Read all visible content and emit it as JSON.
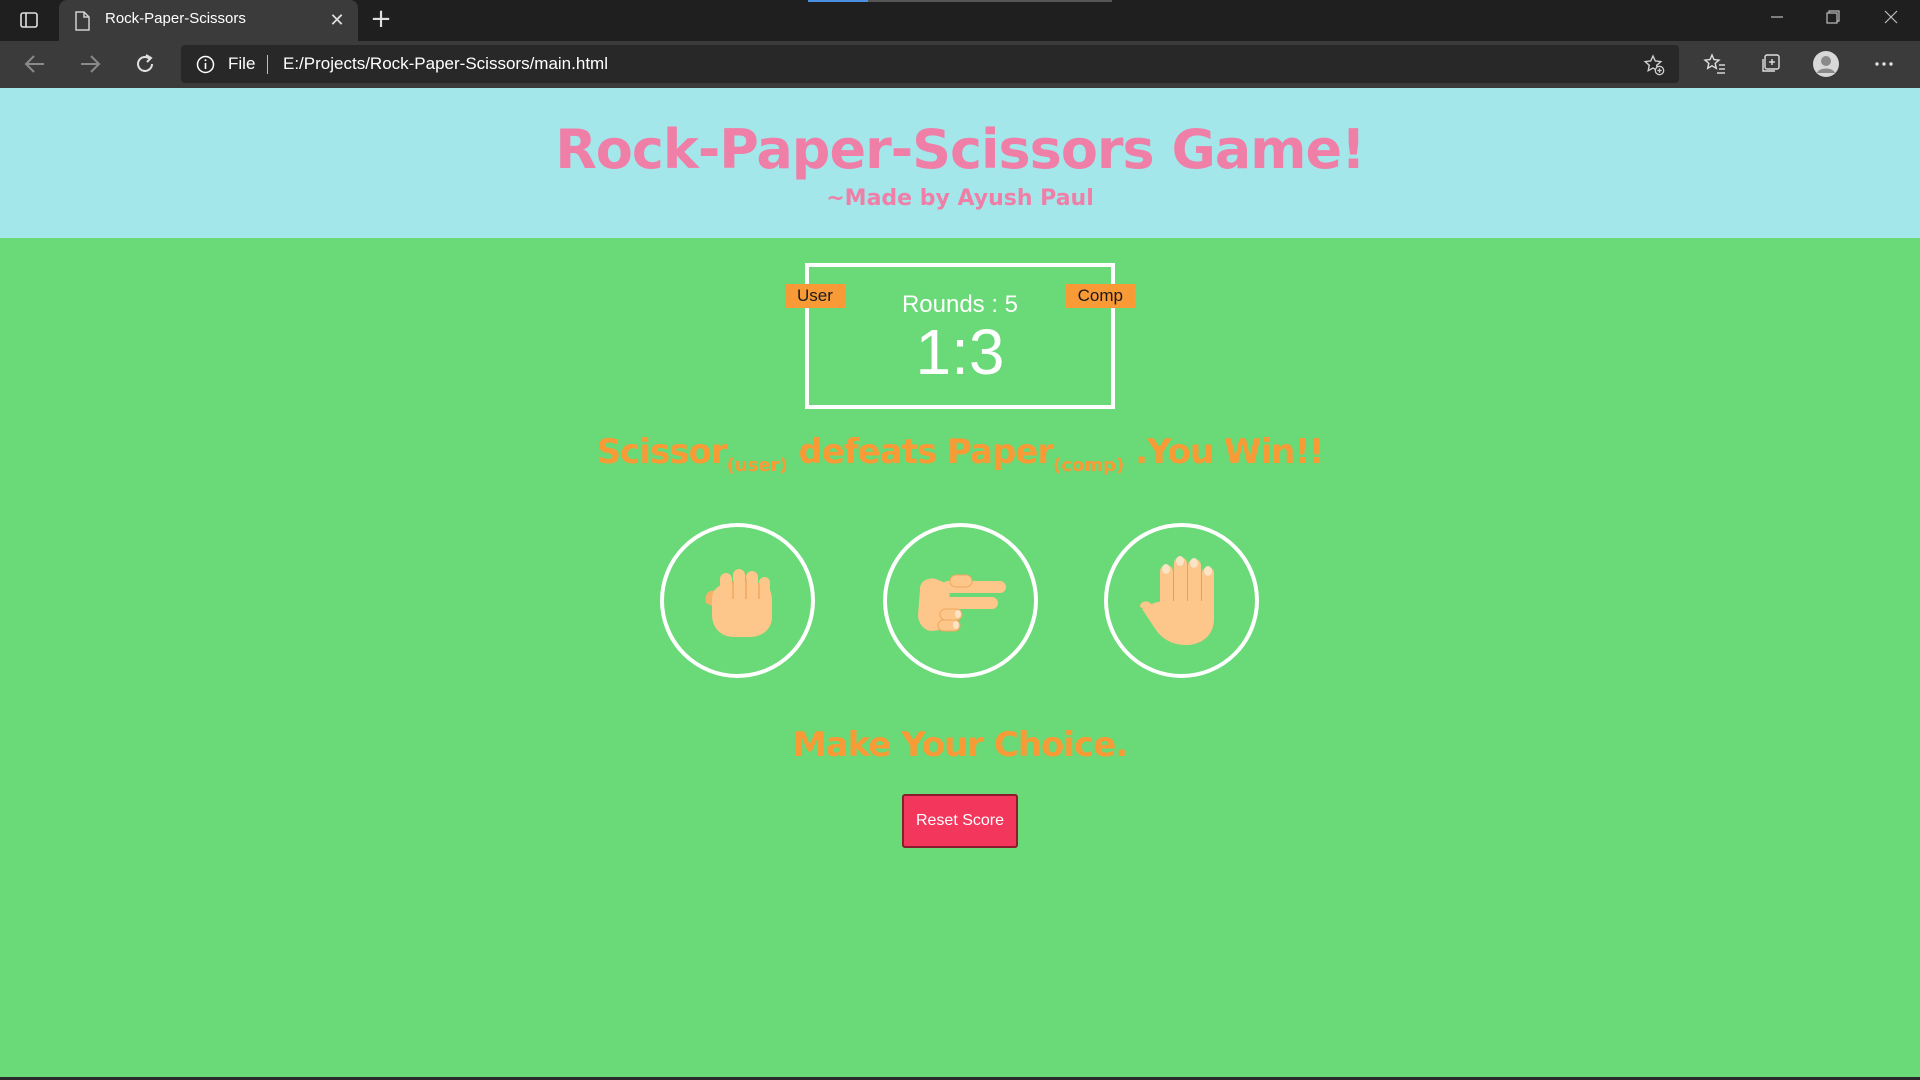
{
  "browser": {
    "tab_title": "Rock-Paper-Scissors",
    "tab_close": "✕",
    "new_tab": "+",
    "scheme_label": "File",
    "url": "E:/Projects/Rock-Paper-Scissors/main.html"
  },
  "header": {
    "title": "Rock-Paper-Scissors Game!",
    "subtitle": "~Made by Ayush Paul"
  },
  "scoreboard": {
    "user_label": "User",
    "comp_label": "Comp",
    "rounds": "Rounds : 5",
    "score": "1:3"
  },
  "result": {
    "user_choice": "Scissor",
    "user_tag": "(user)",
    "verb": " defeats ",
    "comp_choice": "Paper",
    "comp_tag": "(comp)",
    "outcome": " .You Win!!"
  },
  "choices": [
    {
      "name": "rock",
      "icon": "fist-icon"
    },
    {
      "name": "scissors",
      "icon": "scissors-hand-icon"
    },
    {
      "name": "paper",
      "icon": "open-hand-icon"
    }
  ],
  "prompt": "Make Your Choice.",
  "reset_label": "Reset Score",
  "colors": {
    "header_bg": "#a3e7eb",
    "page_bg": "#6ad977",
    "title": "#f07fa8",
    "accent_orange": "#f89a35",
    "reset_button": "#f2365c",
    "skin": "#fdc68a"
  }
}
